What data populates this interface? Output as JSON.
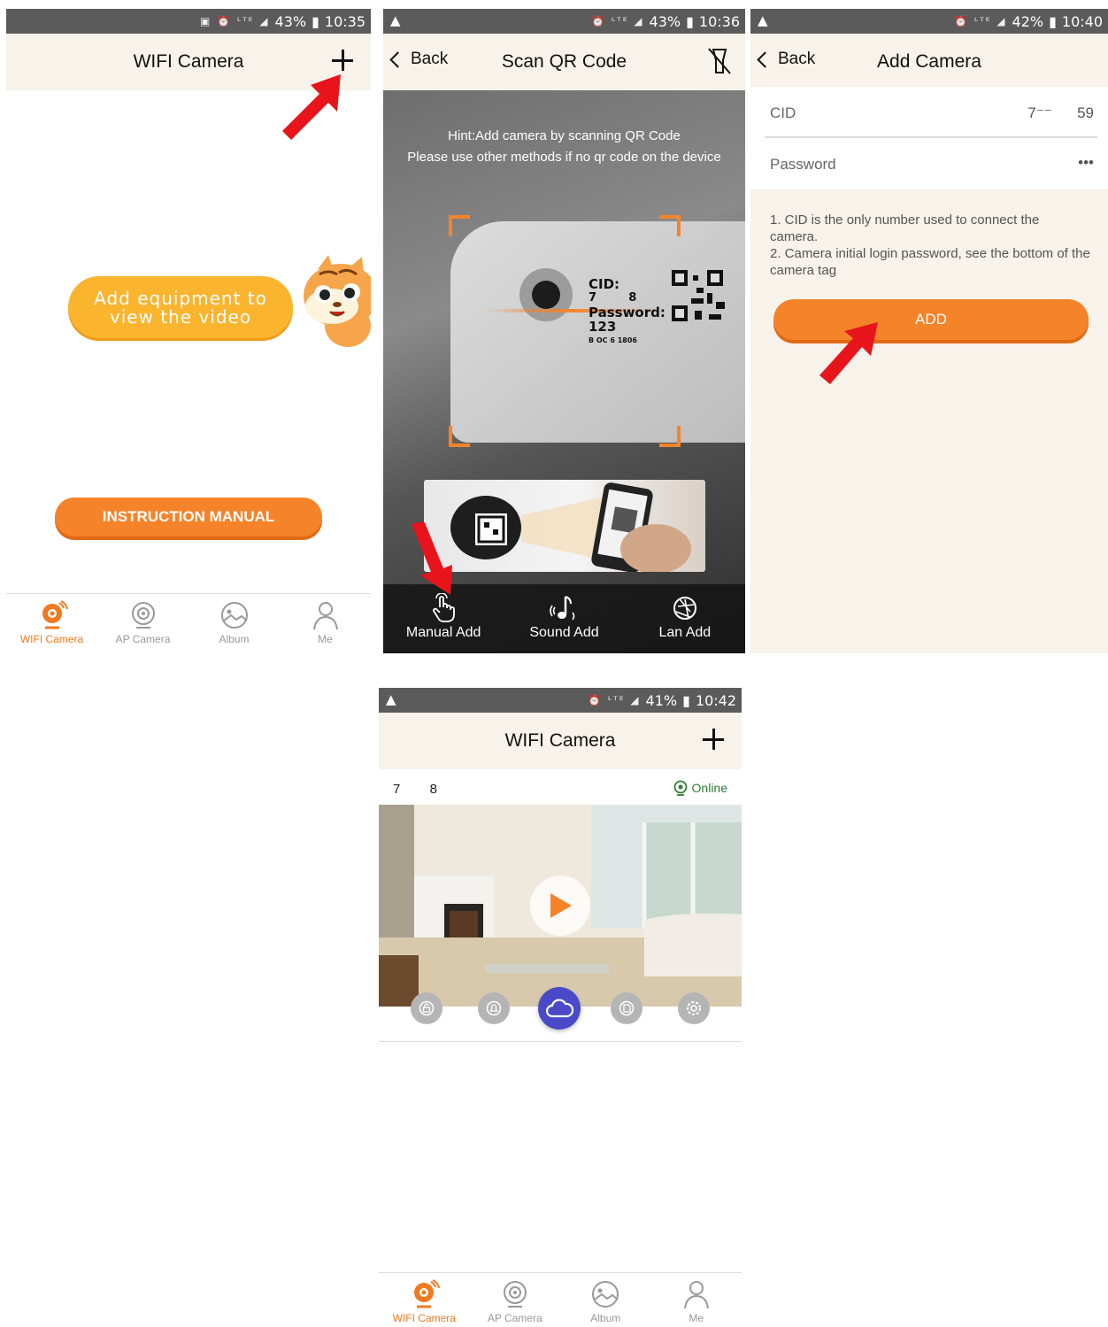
{
  "screen1": {
    "status": {
      "battery": "43%",
      "time": "10:35"
    },
    "title": "WIFI Camera",
    "add_prompt": "Add equipment to view the video",
    "instruction_button": "INSTRUCTION MANUAL",
    "tabs": [
      {
        "label": "WIFI Camera",
        "icon": "webcam-icon"
      },
      {
        "label": "AP Camera",
        "icon": "camera-icon"
      },
      {
        "label": "Album",
        "icon": "album-icon"
      },
      {
        "label": "Me",
        "icon": "user-icon"
      }
    ]
  },
  "screen2": {
    "status": {
      "battery": "43%",
      "time": "10:36"
    },
    "back_label": "Back",
    "title": "Scan QR Code",
    "hint_line1": "Hint:Add camera by scanning QR Code",
    "hint_line2": "Please use other methods if no qr code on the device",
    "label_text": {
      "cid": "CID:",
      "cid_value": "7        8",
      "password": "Password:",
      "password_value": "123",
      "code": "B OC 6 1806"
    },
    "actions": [
      {
        "label": "Manual Add",
        "icon": "hand-tap-icon"
      },
      {
        "label": "Sound Add",
        "icon": "music-note-icon"
      },
      {
        "label": "Lan Add",
        "icon": "aperture-icon"
      }
    ]
  },
  "screen3": {
    "status": {
      "battery": "42%",
      "time": "10:40"
    },
    "back_label": "Back",
    "title": "Add Camera",
    "cid_label": "CID",
    "cid_value": "7⁻⁻      59",
    "password_label": "Password",
    "password_value": "•••",
    "note1": "1. CID is the only number used to connect the camera.",
    "note2": "2. Camera initial login password, see the bottom of the camera tag",
    "add_button": "ADD"
  },
  "screen4": {
    "status": {
      "battery": "41%",
      "time": "10:42"
    },
    "title": "WIFI Camera",
    "device_name": "7        8",
    "device_status": "Online",
    "tabs": [
      {
        "label": "WIFI Camera",
        "icon": "webcam-icon"
      },
      {
        "label": "AP Camera",
        "icon": "camera-icon"
      },
      {
        "label": "Album",
        "icon": "album-icon"
      },
      {
        "label": "Me",
        "icon": "user-icon"
      }
    ]
  },
  "colors": {
    "accent": "#f07a1f",
    "red_arrow": "#e8141b",
    "nav_bg": "#f7f2ea",
    "online": "#2e7d32",
    "cloud_btn": "#4a4ac8"
  }
}
